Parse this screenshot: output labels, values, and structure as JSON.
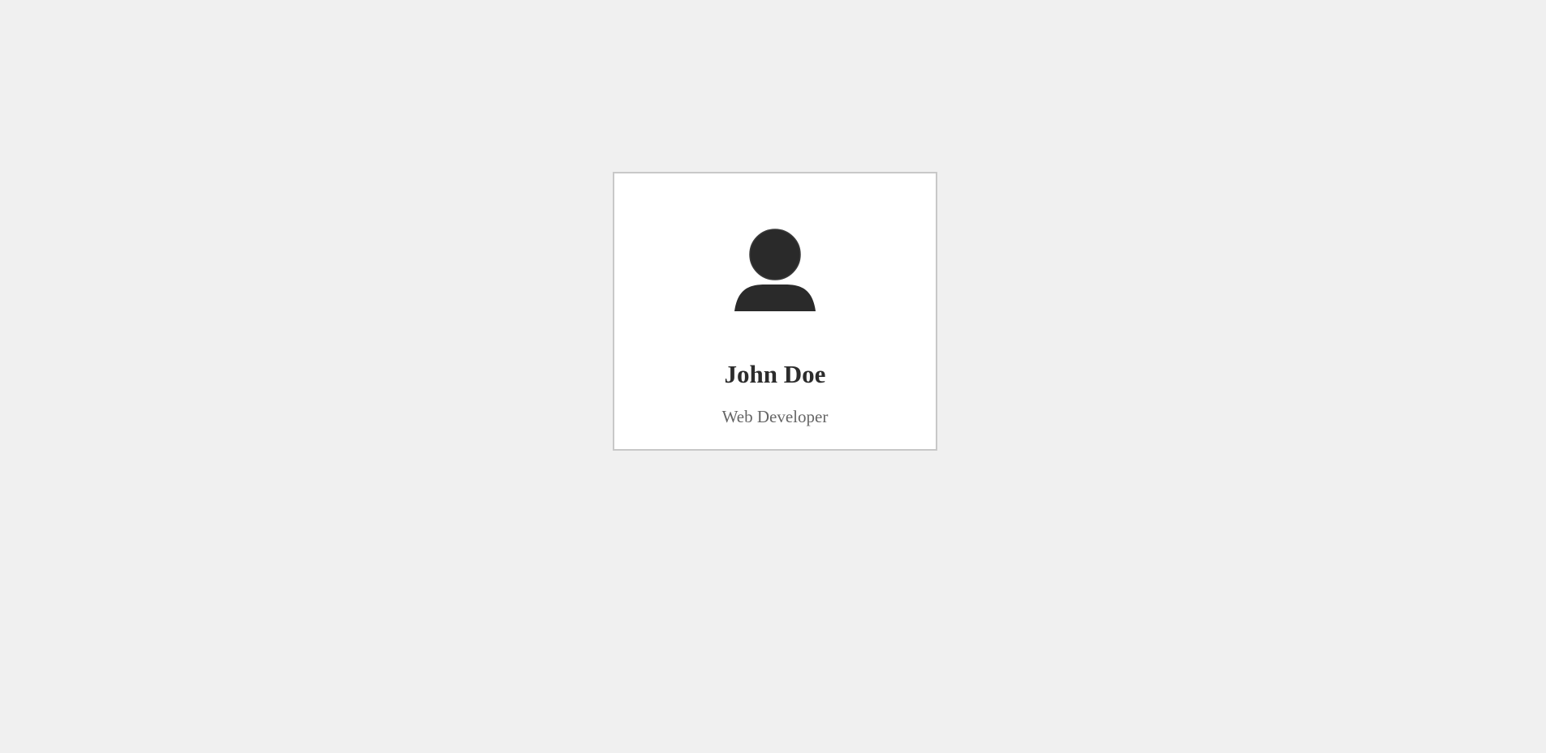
{
  "profile_card": {
    "avatar_icon": "user-silhouette-icon",
    "name": "John Doe",
    "title": "Web Developer"
  },
  "colors": {
    "page_background": "#f0f0f0",
    "card_background": "#ffffff",
    "card_border": "#c8c8c8",
    "icon": "#2a2a2a",
    "name_text": "#2c2c2c",
    "title_text": "#666666"
  }
}
